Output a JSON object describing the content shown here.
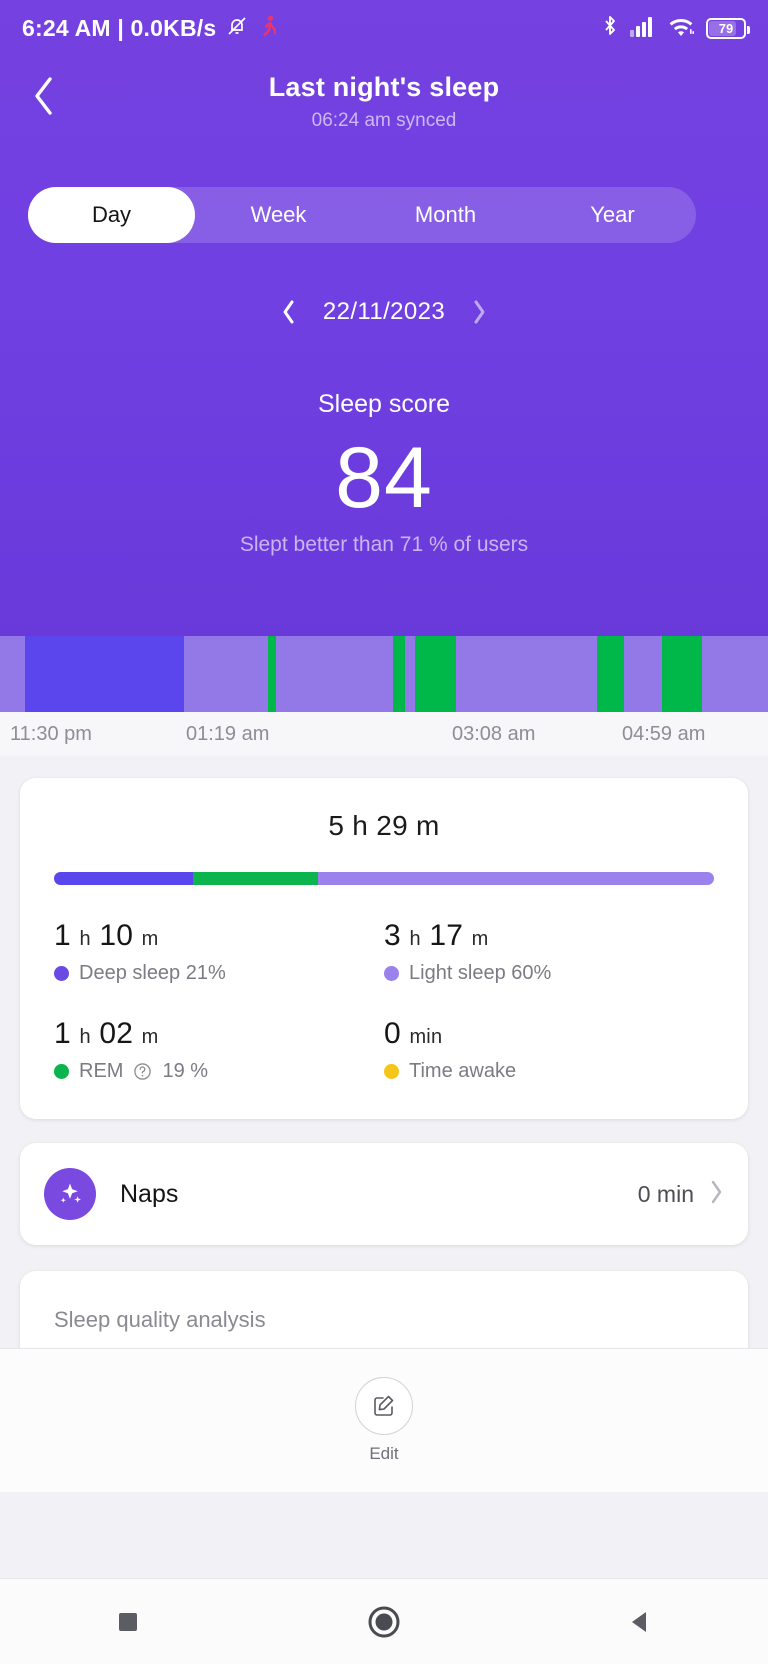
{
  "statusbar": {
    "clock": "6:24 AM | 0.0KB/s",
    "mute_icon": "bell-mute-icon",
    "activity_icon": "running-icon",
    "bluetooth_icon": "bluetooth-icon",
    "signal_icon": "cellular-signal-icon",
    "wifi_icon": "wifi-icon",
    "battery_icon": "battery-icon",
    "battery_level": "79"
  },
  "header": {
    "back_icon": "chevron-left-icon",
    "title": "Last night's sleep",
    "sync_text": "06:24 am synced"
  },
  "tabs": {
    "items": [
      {
        "label": "Day",
        "active": true
      },
      {
        "label": "Week",
        "active": false
      },
      {
        "label": "Month",
        "active": false
      },
      {
        "label": "Year",
        "active": false
      }
    ]
  },
  "date_nav": {
    "prev_icon": "chevron-left-icon",
    "next_icon": "chevron-right-icon",
    "date": "22/11/2023"
  },
  "score": {
    "title": "Sleep score",
    "value": "84",
    "subtitle": "Slept better than 71 % of users"
  },
  "hypnogram": {
    "axis_labels": [
      "11:30 pm",
      "01:19 am",
      "03:08 am",
      "04:59 am"
    ],
    "colors": {
      "deep": "#5b46ee",
      "light": "#9379e8",
      "rem": "#00b74a",
      "awake": "#f5c518"
    },
    "segments": [
      {
        "stage": "light",
        "width": 3.2
      },
      {
        "stage": "deep",
        "width": 20.8
      },
      {
        "stage": "light",
        "width": 10.9
      },
      {
        "stage": "rem",
        "width": 1.1
      },
      {
        "stage": "light",
        "width": 15.2
      },
      {
        "stage": "rem",
        "width": 1.5
      },
      {
        "stage": "light",
        "width": 1.4
      },
      {
        "stage": "rem",
        "width": 5.3
      },
      {
        "stage": "light",
        "width": 18.4
      },
      {
        "stage": "rem",
        "width": 3.4
      },
      {
        "stage": "light",
        "width": 5.0
      },
      {
        "stage": "rem",
        "width": 5.2
      },
      {
        "stage": "light",
        "width": 8.6
      }
    ]
  },
  "summary": {
    "total_duration": "5 h 29 m",
    "stack": [
      {
        "stage": "deep",
        "percent": 21,
        "color": "#5b46ee"
      },
      {
        "stage": "rem",
        "percent": 19,
        "color": "#0bb44c"
      },
      {
        "stage": "light",
        "percent": 60,
        "color": "#9a81ec"
      }
    ],
    "metrics": [
      {
        "value_num1": "1",
        "value_unit1": "h",
        "value_num2": "10",
        "value_unit2": "m",
        "label": "Deep sleep 21%",
        "dot_color": "#6a4be2",
        "has_info": false
      },
      {
        "value_num1": "3",
        "value_unit1": "h",
        "value_num2": "17",
        "value_unit2": "m",
        "label": "Light sleep 60%",
        "dot_color": "#9a81ec",
        "has_info": false
      },
      {
        "value_num1": "1",
        "value_unit1": "h",
        "value_num2": "02",
        "value_unit2": "m",
        "label_pre": "REM",
        "label_post": "19 %",
        "dot_color": "#0bb44c",
        "has_info": true,
        "info_icon": "question-mark-circle-icon"
      },
      {
        "value_num1": "0",
        "value_unit1": "",
        "value_num2": "",
        "value_unit2": "min",
        "label": "Time awake",
        "dot_color": "#f5c518",
        "has_info": false
      }
    ]
  },
  "naps": {
    "icon": "sparkle-star-icon",
    "title": "Naps",
    "value": "0 min",
    "chevron_icon": "chevron-right-icon"
  },
  "analysis": {
    "title": "Sleep quality analysis"
  },
  "editbar": {
    "icon": "edit-pencil-square-icon",
    "label": "Edit"
  },
  "navbar": {
    "recents_icon": "square-recents-icon",
    "home_icon": "circle-home-icon",
    "back_icon": "triangle-back-icon"
  }
}
